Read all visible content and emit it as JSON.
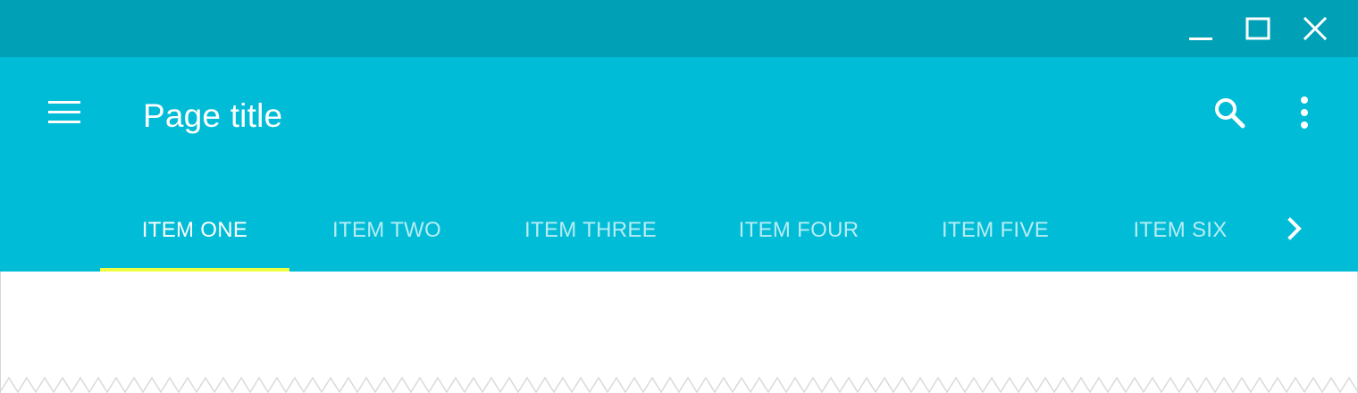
{
  "window": {
    "controls": {
      "minimize_icon": "minimize-icon",
      "maximize_icon": "maximize-icon",
      "close_icon": "close-icon"
    },
    "titlebar_color": "#00A0B6"
  },
  "appbar": {
    "title": "Page title",
    "color": "#00BCD7",
    "menu_icon": "menu-icon",
    "search_icon": "search-icon",
    "more_icon": "more-vert-icon"
  },
  "tabs": {
    "items": [
      {
        "label": "ITEM ONE",
        "active": true
      },
      {
        "label": "ITEM TWO",
        "active": false
      },
      {
        "label": "ITEM THREE",
        "active": false
      },
      {
        "label": "ITEM FOUR",
        "active": false
      },
      {
        "label": "ITEM FIVE",
        "active": false
      },
      {
        "label": "ITEM SIX",
        "active": false
      }
    ],
    "indicator_color": "#EEFF41",
    "scroll_icon": "chevron-right-icon"
  }
}
